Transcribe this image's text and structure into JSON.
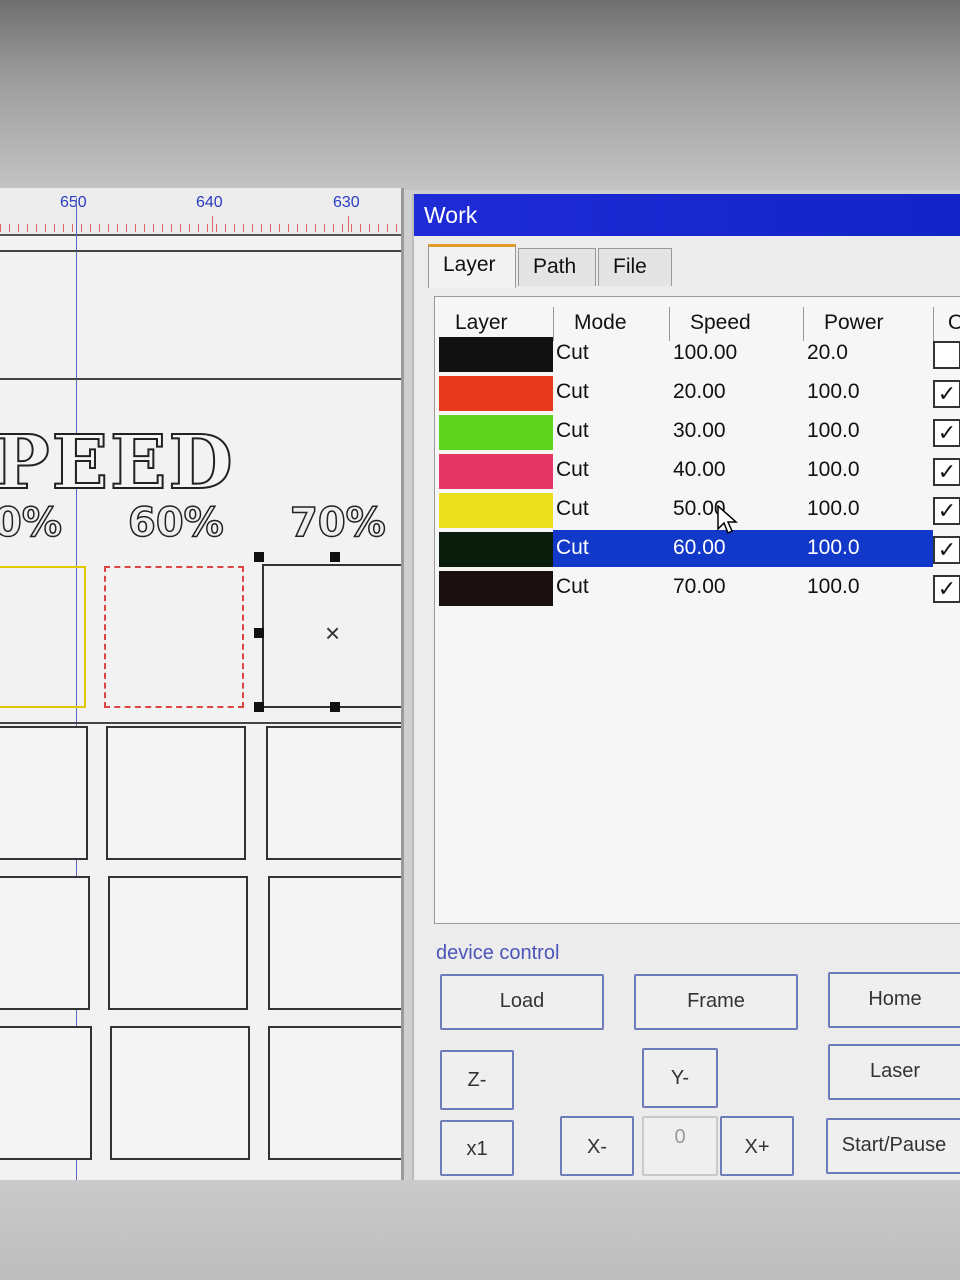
{
  "ruler": {
    "marks": [
      "650",
      "640",
      "630"
    ]
  },
  "canvas": {
    "heading": "PEED",
    "percent_labels": [
      "0%",
      "60%",
      "70%"
    ]
  },
  "work_panel": {
    "title": "Work",
    "tabs": [
      "Layer",
      "Path",
      "File"
    ],
    "active_tab": "Layer",
    "columns": [
      "Layer",
      "Mode",
      "Speed",
      "Power",
      "O"
    ],
    "rows": [
      {
        "color": "#111111",
        "mode": "Cut",
        "speed": "100.00",
        "power": "20.0",
        "checked": false,
        "selected": false
      },
      {
        "color": "#e8391e",
        "mode": "Cut",
        "speed": "20.00",
        "power": "100.0",
        "checked": true,
        "selected": false
      },
      {
        "color": "#5fd51f",
        "mode": "Cut",
        "speed": "30.00",
        "power": "100.0",
        "checked": true,
        "selected": false
      },
      {
        "color": "#e53665",
        "mode": "Cut",
        "speed": "40.00",
        "power": "100.0",
        "checked": true,
        "selected": false
      },
      {
        "color": "#ece01c",
        "mode": "Cut",
        "speed": "50.00",
        "power": "100.0",
        "checked": true,
        "selected": false
      },
      {
        "color": "#0b1e0e",
        "mode": "Cut",
        "speed": "60.00",
        "power": "100.0",
        "checked": true,
        "selected": true
      },
      {
        "color": "#1b0f0f",
        "mode": "Cut",
        "speed": "70.00",
        "power": "100.0",
        "checked": true,
        "selected": false
      }
    ],
    "checkmark": "✓",
    "scroll_arrow": "<",
    "device_control": {
      "label": "device control",
      "buttons": {
        "load": "Load",
        "frame": "Frame",
        "home": "Home",
        "z_minus": "Z-",
        "y_minus": "Y-",
        "laser": "Laser",
        "x1": "x1",
        "x_minus": "X-",
        "zero": "0",
        "x_plus": "X+",
        "start_pause": "Start/Pause"
      }
    },
    "accent_color": "#1224c8",
    "selection_color": "#1238c9"
  }
}
